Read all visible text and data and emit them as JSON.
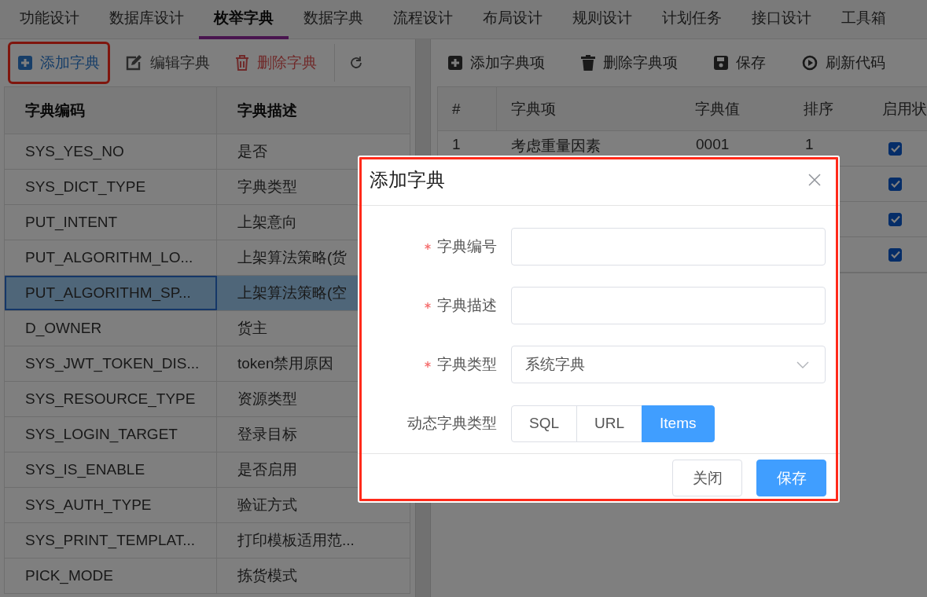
{
  "top_tabs": [
    {
      "label": "功能设计",
      "selected": false
    },
    {
      "label": "数据库设计",
      "selected": false
    },
    {
      "label": "枚举字典",
      "selected": true
    },
    {
      "label": "数据字典",
      "selected": false
    },
    {
      "label": "流程设计",
      "selected": false
    },
    {
      "label": "布局设计",
      "selected": false
    },
    {
      "label": "规则设计",
      "selected": false
    },
    {
      "label": "计划任务",
      "selected": false
    },
    {
      "label": "接口设计",
      "selected": false
    },
    {
      "label": "工具箱",
      "selected": false
    }
  ],
  "dict_panel": {
    "toolbar": [
      {
        "kind": "add",
        "label": "添加字典",
        "highlighted": true
      },
      {
        "kind": "edit",
        "label": "编辑字典",
        "highlighted": false
      },
      {
        "kind": "delete",
        "label": "删除字典",
        "highlighted": false
      },
      {
        "kind": "refresh",
        "highlighted": false
      }
    ],
    "table": {
      "columns": [
        "字典编码",
        "字典描述"
      ],
      "rows": [
        {
          "code": "SYS_YES_NO",
          "description": "是否",
          "selected": false
        },
        {
          "code": "SYS_DICT_TYPE",
          "description": "字典类型",
          "selected": false
        },
        {
          "code": "PUT_INTENT",
          "description": "上架意向",
          "selected": false
        },
        {
          "code": "PUT_ALGORITHM_LO...",
          "description": "上架算法策略(货",
          "selected": false
        },
        {
          "code": "PUT_ALGORITHM_SP...",
          "description": "上架算法策略(空",
          "selected": true
        },
        {
          "code": "D_OWNER",
          "description": "货主",
          "selected": false
        },
        {
          "code": "SYS_JWT_TOKEN_DIS...",
          "description": "token禁用原因",
          "selected": false
        },
        {
          "code": "SYS_RESOURCE_TYPE",
          "description": "资源类型",
          "selected": false
        },
        {
          "code": "SYS_LOGIN_TARGET",
          "description": "登录目标",
          "selected": false
        },
        {
          "code": "SYS_IS_ENABLE",
          "description": "是否启用",
          "selected": false
        },
        {
          "code": "SYS_AUTH_TYPE",
          "description": "验证方式",
          "selected": false
        },
        {
          "code": "SYS_PRINT_TEMPLAT...",
          "description": "打印模板适用范...",
          "selected": false
        },
        {
          "code": "PICK_MODE",
          "description": "拣货模式",
          "selected": false
        }
      ]
    }
  },
  "items_panel": {
    "toolbar": [
      {
        "kind": "add",
        "label": "添加字典项"
      },
      {
        "kind": "delete",
        "label": "删除字典项"
      },
      {
        "kind": "save",
        "label": "保存"
      },
      {
        "kind": "refresh",
        "label": "刷新代码"
      }
    ],
    "table": {
      "columns": [
        "#",
        "字典项",
        "字典值",
        "排序",
        "启用状"
      ],
      "rows": [
        {
          "number": "1",
          "item": "考虑重量因素",
          "value": "0001",
          "order": "1",
          "enabled": true
        },
        {
          "enabled": true
        },
        {
          "enabled": true
        },
        {
          "enabled": true
        }
      ]
    }
  },
  "dialog": {
    "title": "添加字典",
    "highlighted": true,
    "fields": [
      {
        "kind": "input",
        "label": "字典编号",
        "required": true
      },
      {
        "kind": "input",
        "label": "字典描述",
        "required": true
      },
      {
        "kind": "select",
        "label": "字典类型",
        "required": true,
        "value": "系统字典"
      },
      {
        "kind": "segmented",
        "label": "动态字典类型",
        "options": [
          {
            "label": "SQL",
            "selected": false
          },
          {
            "label": "URL",
            "selected": false
          },
          {
            "label": "Items",
            "selected": true
          }
        ]
      }
    ],
    "buttons": [
      {
        "kind": "default",
        "label": "关闭"
      },
      {
        "kind": "primary",
        "label": "保存"
      }
    ]
  }
}
